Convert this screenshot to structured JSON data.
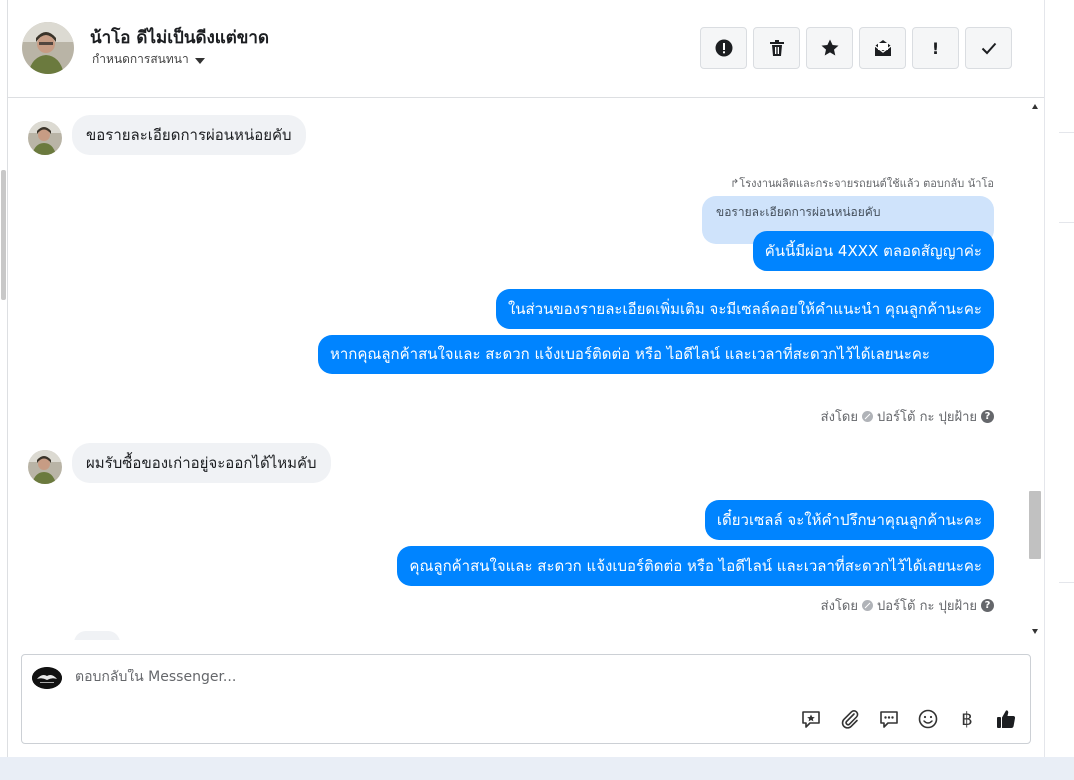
{
  "conversation": {
    "contact_name": "น้าโอ ดีไม่เป็นดีงแต่ขาด",
    "assign_label": "กำหนดการสนทนา"
  },
  "toolbar": [
    {
      "name": "spam-button",
      "icon": "alert-circle-icon"
    },
    {
      "name": "delete-button",
      "icon": "trash-icon"
    },
    {
      "name": "star-button",
      "icon": "star-icon"
    },
    {
      "name": "mark-unread-button",
      "icon": "envelope-open-icon"
    },
    {
      "name": "follow-up-button",
      "icon": "exclamation-icon",
      "text": "!"
    },
    {
      "name": "mark-done-button",
      "icon": "checkmark-icon"
    }
  ],
  "messages": {
    "m1": "ขอรายละเอียดการผ่อนหน่อยคับ",
    "reply_note": "↱โรงงานผลิตและกระจายรถยนต์ใช้แล้ว ตอบกลับ น้าโอ",
    "reply_quote": "ขอรายละเอียดการผ่อนหน่อยคับ",
    "m2": "คันนี้มีผ่อน 4XXX ตลอดสัญญาค่ะ",
    "m3": "ในส่วนของรายละเอียดเพิ่มเติม จะมีเซลล์คอยให้คำแนะนำ คุณลูกค้านะคะ",
    "m4": "หากคุณลูกค้าสนใจและ สะดวก แจ้งเบอร์ติดต่อ หรือ ไอดีไลน์ และเวลาที่สะดวกไว้ได้เลยนะคะ",
    "sent_by_1": {
      "prefix": "ส่งโดย",
      "agent": "ปอร์โต้ กะ ปุยฝ้าย",
      "help": "?"
    },
    "m5": "ผมรับซื้อของเก่าอยู่จะออกได้ไหมคับ",
    "m6": "เดี๋ยวเซลล์ จะให้คำปรึกษาคุณลูกค้านะคะ",
    "m7": "คุณลูกค้าสนใจและ สะดวก แจ้งเบอร์ติดต่อ หรือ ไอดีไลน์ และเวลาที่สะดวกไว้ได้เลยนะคะ",
    "sent_by_2": {
      "prefix": "ส่งโดย",
      "agent": "ปอร์โต้ กะ ปุยฝ้าย",
      "help": "?"
    }
  },
  "composer": {
    "placeholder": "ตอบกลับใน Messenger...",
    "value": "",
    "icons": [
      "saved-reply-icon",
      "attachment-icon",
      "quick-replies-icon",
      "emoji-icon",
      "baht-payment-icon",
      "thumbs-up-icon"
    ],
    "baht_symbol": "฿"
  },
  "colors": {
    "outgoing_bubble": "#0084ff",
    "incoming_bubble": "#f0f2f5",
    "reply_quote": "#cfe3fb"
  }
}
